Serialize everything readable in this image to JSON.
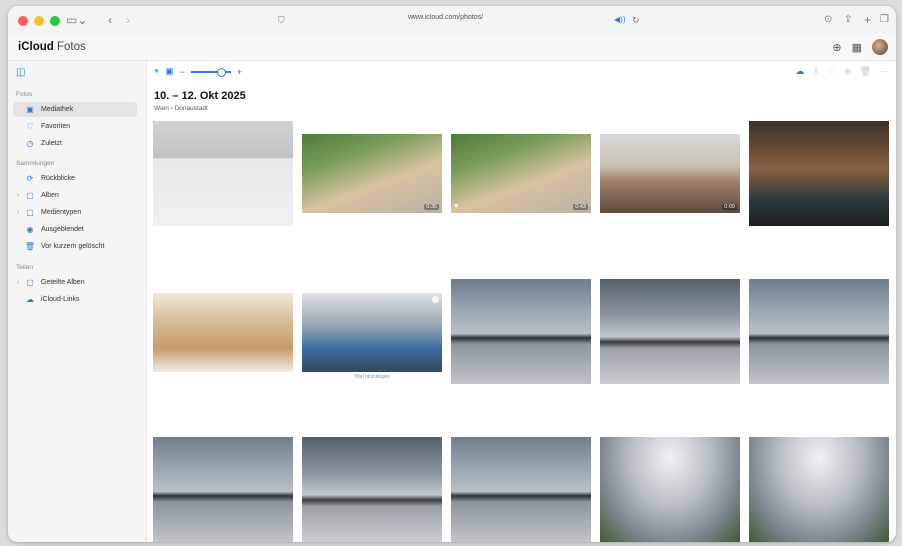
{
  "browser": {
    "url": "www.icloud.com/photos/"
  },
  "app": {
    "brand_apple": "",
    "brand_bold": "iCloud",
    "brand_light": "Fotos"
  },
  "sidebar": {
    "section_fotos": "Fotos",
    "section_sammlungen": "Sammlungen",
    "section_teilen": "Teilen",
    "fotos_items": [
      {
        "label": "Mediathek",
        "icon": "photo-library-icon"
      },
      {
        "label": "Favoriten",
        "icon": "heart-icon"
      },
      {
        "label": "Zuletzt",
        "icon": "clock-icon"
      }
    ],
    "sammlungen_items": [
      {
        "label": "Rückblicke",
        "icon": "memories-icon"
      },
      {
        "label": "Alben",
        "icon": "album-icon"
      },
      {
        "label": "Medientypen",
        "icon": "media-types-icon"
      },
      {
        "label": "Ausgeblendet",
        "icon": "hidden-eye-icon"
      },
      {
        "label": "Vor kurzem gelöscht",
        "icon": "trash-icon"
      }
    ],
    "teilen_items": [
      {
        "label": "Geteilte Alben",
        "icon": "shared-album-icon"
      },
      {
        "label": "iCloud-Links",
        "icon": "cloud-link-icon"
      }
    ]
  },
  "main": {
    "date_range": "10. – 12. Okt 2025",
    "location": "Wien › Donaustadt",
    "caption_add": "Titel hinzufügen",
    "photos": [
      {
        "kind": "hall",
        "duration": ""
      },
      {
        "kind": "palm",
        "duration": "0:35"
      },
      {
        "kind": "palm",
        "duration": "0:43",
        "favorite": true
      },
      {
        "kind": "man1",
        "duration": "0:09"
      },
      {
        "kind": "stand",
        "duration": ""
      },
      {
        "kind": "sofa",
        "duration": ""
      },
      {
        "kind": "cup",
        "duration": ""
      },
      {
        "kind": "river",
        "duration": ""
      },
      {
        "kind": "river2",
        "duration": ""
      },
      {
        "kind": "river",
        "duration": ""
      },
      {
        "kind": "river",
        "duration": ""
      },
      {
        "kind": "river2",
        "duration": ""
      },
      {
        "kind": "river",
        "duration": ""
      },
      {
        "kind": "fish",
        "duration": ""
      },
      {
        "kind": "fish",
        "duration": ""
      }
    ]
  },
  "colors": {
    "accent": "#2a7ad6",
    "close": "#ff5f57",
    "minimize": "#febc2e",
    "zoom": "#28c840"
  }
}
